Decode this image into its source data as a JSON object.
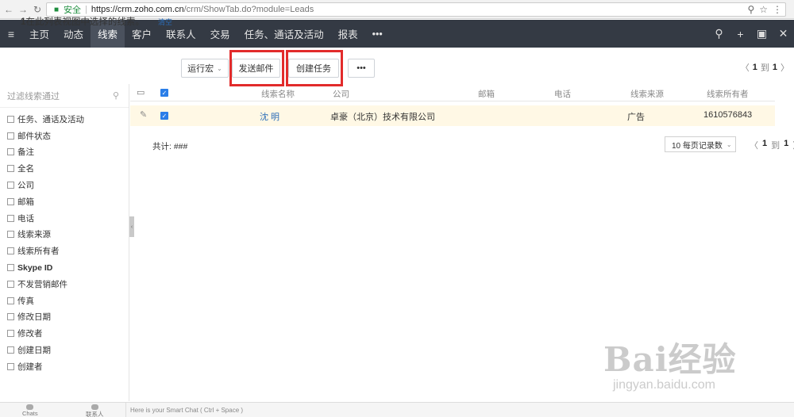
{
  "browser": {
    "secure_label": "安全",
    "url_host": "https://crm.zoho.com.cn",
    "url_path": "/crm/ShowTab.do?module=Leads"
  },
  "nav": {
    "items": [
      "主页",
      "动态",
      "线索",
      "客户",
      "联系人",
      "交易",
      "任务、通话及活动",
      "报表",
      "•••"
    ],
    "active": "线索"
  },
  "toolbar": {
    "selected_count": "1",
    "selected_text": "在此列表视图中选择的线索。",
    "clear_label": "清空",
    "macro_label": "运行宏",
    "send_email_label": "发送邮件",
    "create_task_label": "创建任务",
    "more_label": "•••",
    "pager": {
      "from": "1",
      "to_word": "到",
      "to": "1"
    }
  },
  "sidebar": {
    "filter_placeholder": "过滤线索通过",
    "items": [
      "任务、通话及活动",
      "邮件状态",
      "备注",
      "全名",
      "公司",
      "邮箱",
      "电话",
      "线索来源",
      "线索所有者",
      "Skype ID",
      "不发营销邮件",
      "传真",
      "修改日期",
      "修改者",
      "创建日期",
      "创建者"
    ]
  },
  "table": {
    "headers": {
      "name": "线索名称",
      "company": "公司",
      "email": "邮箱",
      "phone": "电话",
      "source": "线索来源",
      "owner": "线索所有者"
    },
    "rows": [
      {
        "name": "沈 明",
        "company": "卓豪（北京）技术有限公司",
        "email": "",
        "phone": "",
        "source": "广告",
        "owner": "1610576843"
      }
    ],
    "total_label": "共计: ###",
    "per_page_label": "10 每页记录数",
    "pager": {
      "from": "1",
      "to_word": "到",
      "to": "1"
    }
  },
  "bottom": {
    "chats_label": "Chats",
    "contacts_label": "联系人",
    "smart_chat_placeholder": "Here is your Smart Chat ( Ctrl + Space )"
  },
  "watermark": {
    "main": "Bai经验",
    "sub": "jingyan.baidu.com"
  }
}
